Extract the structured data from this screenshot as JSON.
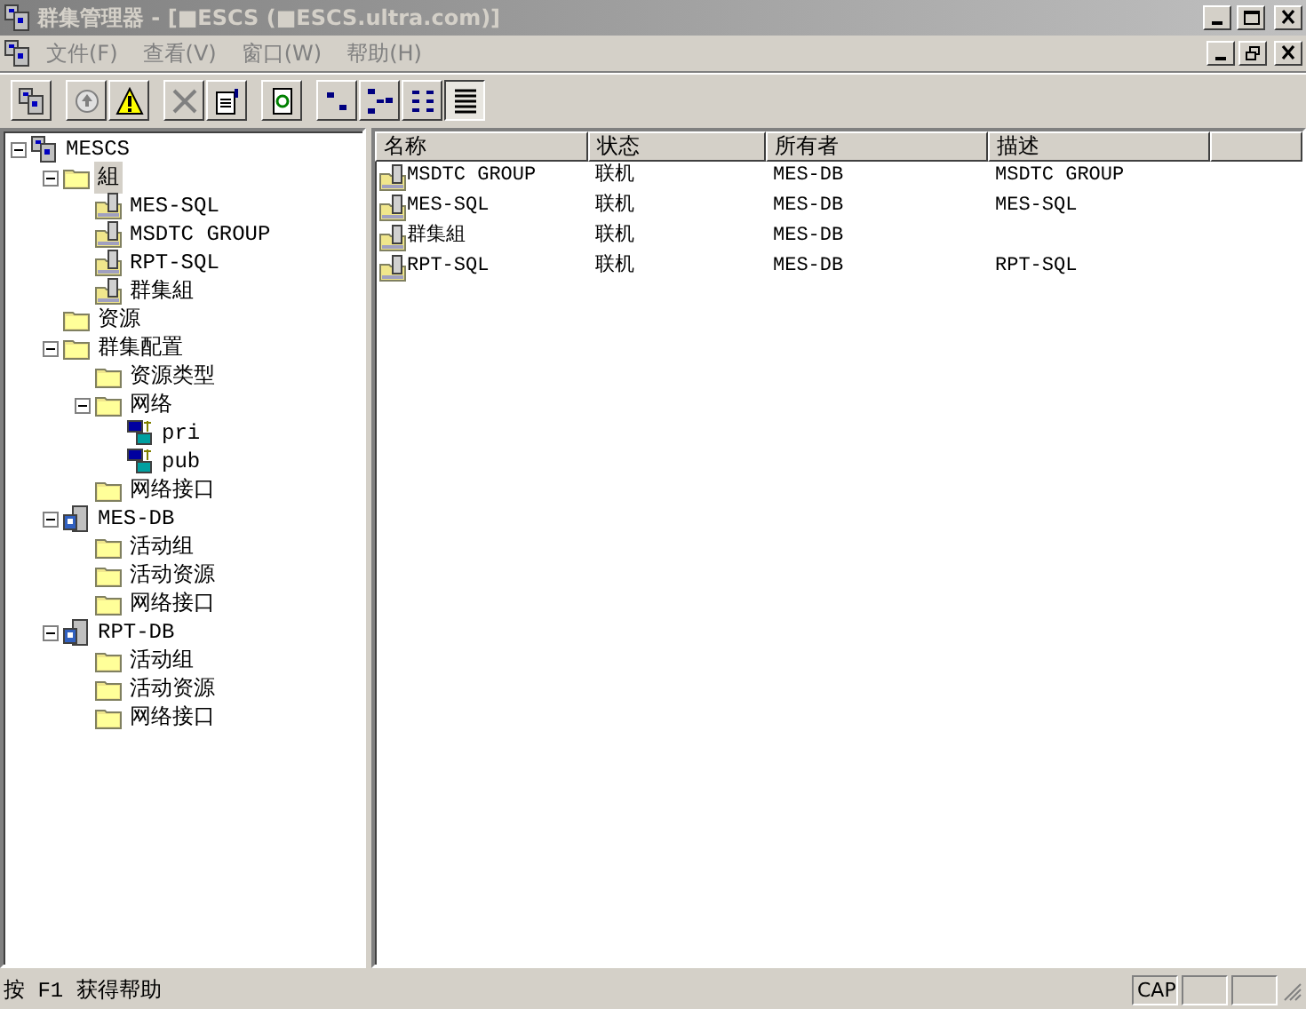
{
  "window": {
    "title": "群集管理器 - [■ESCS (■ESCS.ultra.com)]",
    "active": false
  },
  "menu": [
    "文件(F)",
    "查看(V)",
    "窗口(W)",
    "帮助(H)"
  ],
  "toolbar": [
    [
      {
        "pressed": false
      }
    ],
    [
      {
        "pressed": false
      },
      {
        "pressed": false
      }
    ],
    [
      {
        "pressed": false
      },
      {
        "pressed": false
      }
    ],
    [
      {
        "pressed": false
      }
    ],
    [
      {
        "pressed": false
      },
      {
        "pressed": false
      },
      {
        "pressed": false
      },
      {
        "pressed": true
      }
    ]
  ],
  "tree": [
    {
      "label": "MESCS",
      "kind": "cluster",
      "expanded": true,
      "selected": false,
      "children": [
        {
          "label": "組",
          "kind": "folder",
          "expanded": true,
          "selected": true,
          "children": [
            {
              "label": "MES-SQL",
              "kind": "group",
              "selected": false
            },
            {
              "label": "MSDTC GROUP",
              "kind": "group",
              "selected": false
            },
            {
              "label": "RPT-SQL",
              "kind": "group",
              "selected": false
            },
            {
              "label": "群集組",
              "kind": "group",
              "selected": false
            }
          ]
        },
        {
          "label": "资源",
          "kind": "folder",
          "selected": false
        },
        {
          "label": "群集配置",
          "kind": "folder",
          "expanded": true,
          "selected": false,
          "children": [
            {
              "label": "资源类型",
              "kind": "folder",
              "selected": false
            },
            {
              "label": "网络",
              "kind": "folder",
              "expanded": true,
              "selected": false,
              "children": [
                {
                  "label": "pri",
                  "kind": "network",
                  "selected": false
                },
                {
                  "label": "pub",
                  "kind": "network",
                  "selected": false
                }
              ]
            },
            {
              "label": "网络接口",
              "kind": "folder",
              "selected": false
            }
          ]
        },
        {
          "label": "MES-DB",
          "kind": "node",
          "expanded": true,
          "selected": false,
          "children": [
            {
              "label": "活动组",
              "kind": "folder",
              "selected": false
            },
            {
              "label": "活动资源",
              "kind": "folder",
              "selected": false
            },
            {
              "label": "网络接口",
              "kind": "folder",
              "selected": false
            }
          ]
        },
        {
          "label": "RPT-DB",
          "kind": "node",
          "expanded": true,
          "selected": false,
          "children": [
            {
              "label": "活动组",
              "kind": "folder",
              "selected": false
            },
            {
              "label": "活动资源",
              "kind": "folder",
              "selected": false
            },
            {
              "label": "网络接口",
              "kind": "folder",
              "selected": false
            }
          ]
        }
      ]
    }
  ],
  "table": {
    "columns": [
      "名称",
      "状态",
      "所有者",
      "描述"
    ],
    "rows": [
      [
        "MSDTC GROUP",
        "联机",
        "MES-DB",
        "MSDTC GROUP"
      ],
      [
        "MES-SQL",
        "联机",
        "MES-DB",
        "MES-SQL"
      ],
      [
        "群集組",
        "联机",
        "MES-DB",
        ""
      ],
      [
        "RPT-SQL",
        "联机",
        "MES-DB",
        "RPT-SQL"
      ]
    ]
  },
  "status_bar": {
    "text": "按 F1 获得帮助",
    "indicators": [
      "CAP"
    ]
  }
}
